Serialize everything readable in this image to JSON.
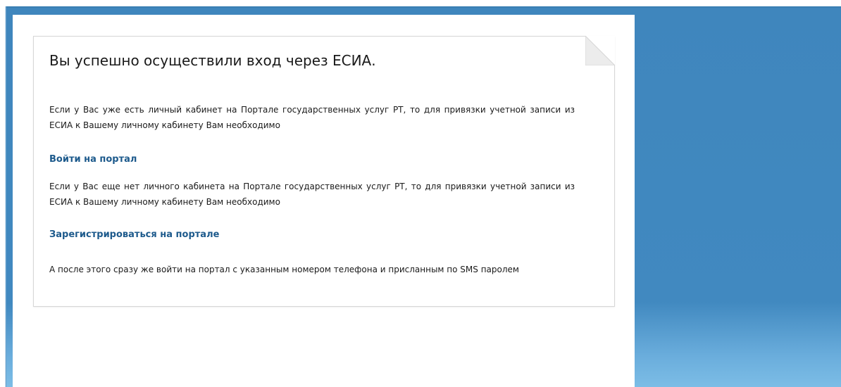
{
  "card": {
    "heading": "Вы успешно осуществили вход через ЕСИА.",
    "intro_existing": "Если у Вас уже есть личный кабинет на Портале государственных услуг РТ, то для привязки учетной записи из ЕСИА к Вашему личному кабинету Вам необходимо",
    "login_link": "Войти на портал",
    "intro_new": "Если у Вас еще нет личного кабинета на Портале государственных услуг РТ, то для привязки учетной записи из ЕСИА к Вашему личному кабинету Вам необходимо",
    "register_link": "Зарегистрироваться на портале",
    "after_note": "А после этого сразу же войти на портал с указанным номером телефона и присланным по SMS паролем"
  },
  "colors": {
    "background_blue": "#4189c0",
    "link": "#1d5a8c",
    "text": "#1a1a1a",
    "card_border": "#d6d6d6"
  }
}
